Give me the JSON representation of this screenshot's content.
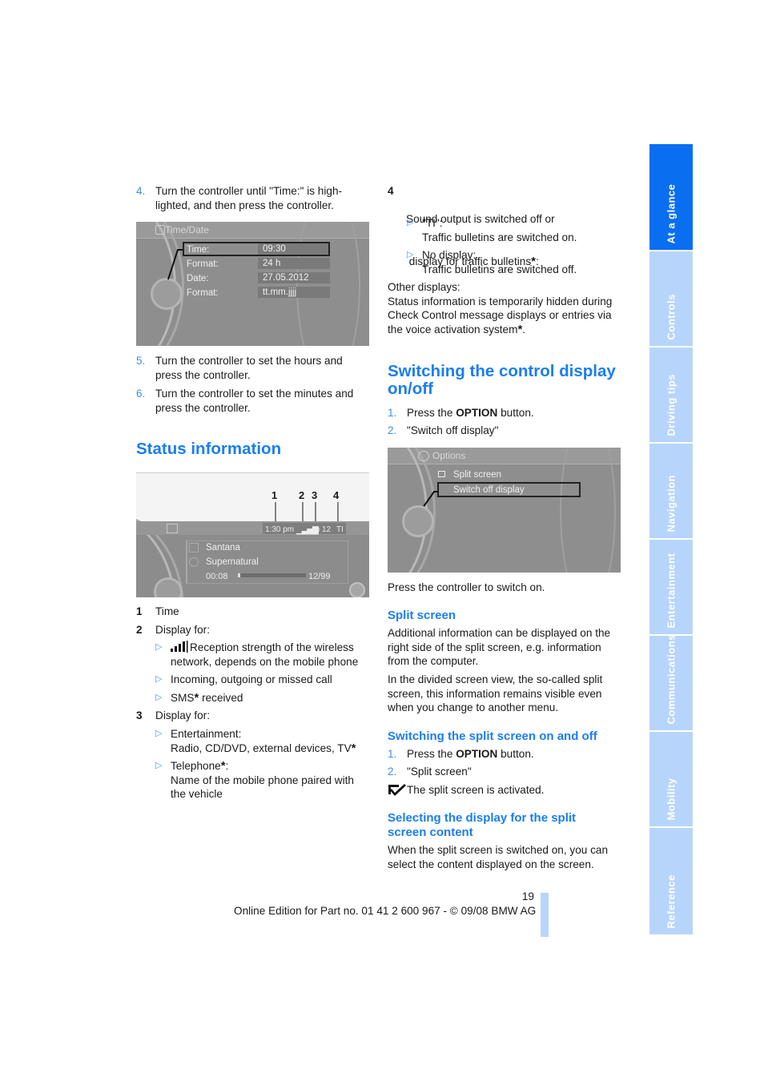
{
  "left_column": {
    "steps_a": [
      {
        "num": "4.",
        "lines": [
          "Turn the controller until \"Time:\" is high-",
          "lighted, and then press the controller."
        ]
      },
      {
        "num": "5.",
        "lines": [
          "Turn the controller to set the hours and",
          "press the controller."
        ]
      },
      {
        "num": "6.",
        "lines": [
          "Turn the controller to set the minutes and",
          "press the controller."
        ]
      }
    ],
    "timedate_screen": {
      "title": "Time/Date",
      "rows": [
        {
          "label": "Time:",
          "value": "09:30",
          "selected": true
        },
        {
          "label": "Format:",
          "value": "24 h"
        },
        {
          "label": "Date:",
          "value": "27.05.2012"
        },
        {
          "label": "Format:",
          "value": "tt.mm.jjjj"
        }
      ]
    },
    "status_heading": "Status information",
    "status_screen": {
      "callouts": [
        "1",
        "2",
        "3",
        "4"
      ],
      "time": "1:30 pm",
      "disc": "12",
      "ti": "TI",
      "artist": "Santana",
      "album": "Supernatural",
      "elapsed": "00:08",
      "track": "12/99",
      "progress_fraction": 0.02
    },
    "legend": [
      {
        "num": "1",
        "text": "Time"
      },
      {
        "num": "2",
        "text": "Display for:",
        "bullets": [
          {
            "lines": [
              "Reception strength of the wireless",
              "network, depends on the mobile phone"
            ],
            "icon": "signal-strength"
          },
          {
            "lines": [
              "Incoming, outgoing or missed call"
            ]
          },
          {
            "lines": [
              "SMS* received"
            ]
          }
        ]
      },
      {
        "num": "3",
        "text": "Display for:",
        "bullets": [
          {
            "lines": [
              "Entertainment:",
              "Radio, CD/DVD, external devices, TV*"
            ]
          },
          {
            "lines": [
              "Telephone*:",
              "Name of the mobile phone paired with",
              "the vehicle"
            ]
          }
        ]
      }
    ]
  },
  "right_column": {
    "item4": {
      "num": "4",
      "lines": [
        "Sound output is switched off or",
        " display for traffic bulletins*:"
      ],
      "bullets": [
        {
          "lines": [
            "\"TI\":",
            "Traffic bulletins are switched on."
          ]
        },
        {
          "lines": [
            "No display:",
            "Traffic bulletins are switched off."
          ]
        }
      ]
    },
    "other_displays": [
      "Other displays:",
      "Status information is temporarily hidden during",
      "Check Control message displays or entries via",
      "the voice activation system*."
    ],
    "switching_heading": [
      "Switching the control display",
      "on/off"
    ],
    "switching_steps": [
      {
        "num": "1.",
        "pre": "Press the ",
        "bold": "OPTION",
        "post": " button."
      },
      {
        "num": "2.",
        "pre": "\"Switch off display\"",
        "bold": "",
        "post": ""
      }
    ],
    "options_screen": {
      "title": "Options",
      "items": [
        "Split screen",
        "Switch off display"
      ],
      "selected_index": 1
    },
    "press_to_switch_on": "Press the controller to switch on.",
    "split_heading": "Split screen",
    "split_p1": [
      "Additional information can be displayed on the",
      "right side of the split screen, e.g. information",
      "from the computer."
    ],
    "split_p2": [
      "In the divided screen view, the so-called split",
      "screen, this information remains visible even",
      "when you change to another menu."
    ],
    "split_onoff_heading": "Switching the split screen on and off",
    "split_onoff_steps": [
      {
        "num": "1.",
        "pre": "Press the ",
        "bold": "OPTION",
        "post": " button."
      },
      {
        "num": "2.",
        "pre": "\"Split screen\"",
        "bold": "",
        "post": ""
      }
    ],
    "split_activated": "The split screen is activated.",
    "select_heading": [
      "Selecting the display for the split",
      "screen content"
    ],
    "select_text": [
      "When the split screen is switched on, you can",
      "select the content displayed on the screen."
    ]
  },
  "footer": {
    "page_number": "19",
    "edition": "Online Edition for Part no. 01 41 2 600 967  - © 09/08 BMW AG"
  },
  "sidebar": {
    "tabs": [
      {
        "label": "At a glance",
        "active": true
      },
      {
        "label": "Controls"
      },
      {
        "label": "Driving tips"
      },
      {
        "label": "Navigation"
      },
      {
        "label": "Entertainment"
      },
      {
        "label": "Communications"
      },
      {
        "label": "Mobility"
      },
      {
        "label": "Reference"
      }
    ],
    "active_color": "#0a6ef0",
    "inactive_color": "#b7d5fb"
  }
}
